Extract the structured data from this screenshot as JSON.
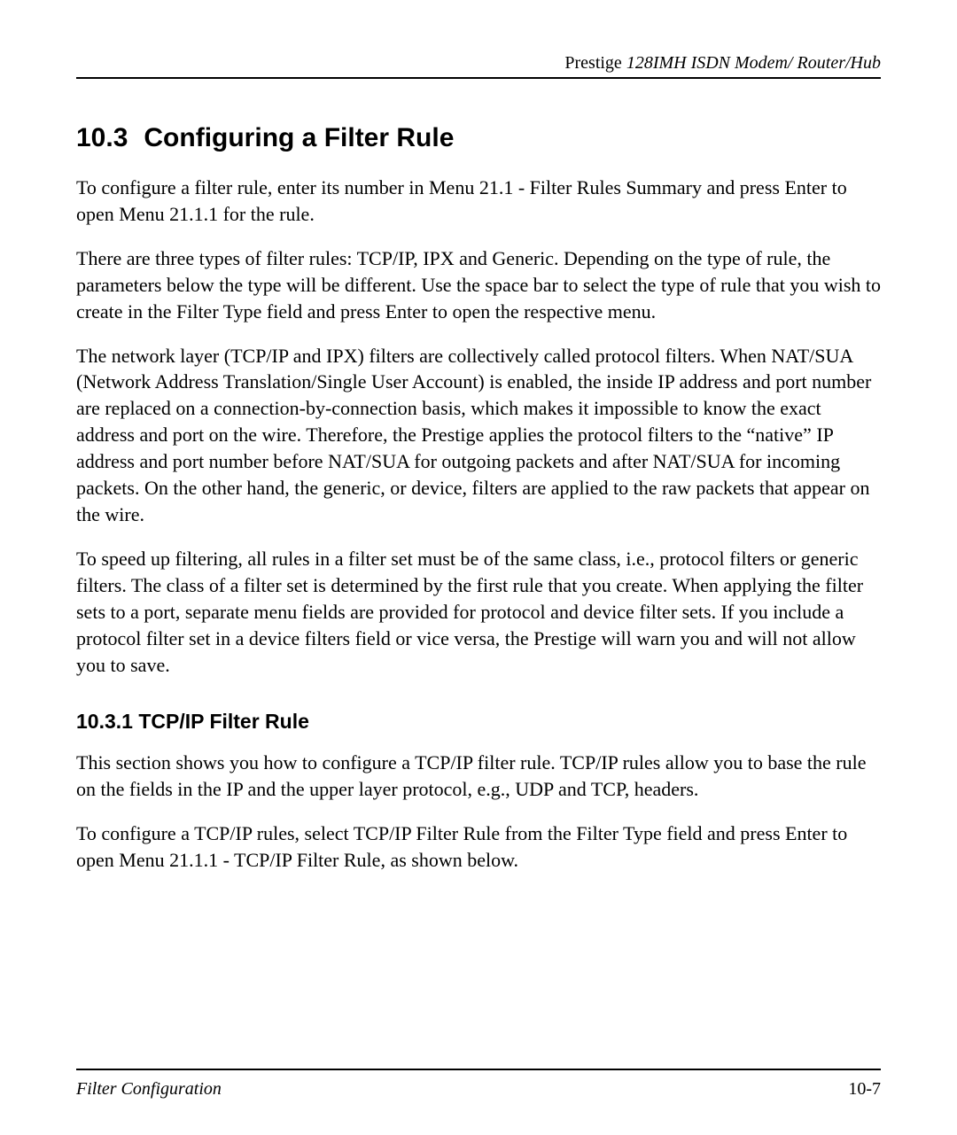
{
  "header": {
    "prefix": "Prestige ",
    "suffix": "128IMH  ISDN Modem/ Router/Hub"
  },
  "section": {
    "number": "10.3",
    "title": "Configuring a Filter Rule"
  },
  "paragraphs": {
    "p1": "To configure a filter rule, enter its number in Menu 21.1 - Filter Rules Summary and press Enter to open Menu 21.1.1 for the rule.",
    "p2": "There are three types of filter rules: TCP/IP, IPX and Generic.  Depending on the type of rule, the parameters below the type will be different.  Use the space bar to select the type of rule that you wish to create in the Filter Type field and press Enter to open the respective menu.",
    "p3": "The network layer (TCP/IP and IPX) filters are collectively called protocol filters. When NAT/SUA (Network Address Translation/Single User Account) is enabled, the inside IP address and port number are replaced on a connection-by-connection basis, which makes it impossible to know the exact address and port on the wire.  Therefore, the Prestige applies the protocol filters to the “native” IP address and port number before NAT/SUA for outgoing packets and after NAT/SUA for incoming packets.  On the other hand, the generic, or device, filters are applied to the raw packets that appear on the wire.",
    "p4": "To speed up filtering, all rules in a filter set must be of the same class, i.e., protocol filters or generic filters.  The class of a filter set is determined by the first rule that you create.  When applying the filter sets to a port, separate menu fields are provided for protocol and device filter sets.  If you include a protocol filter set in a device filters field or vice versa, the Prestige will warn you and will not allow you to save."
  },
  "subsection": {
    "number": "10.3.1",
    "title": "TCP/IP Filter Rule"
  },
  "subparagraphs": {
    "p1": "This section shows you how to configure a TCP/IP filter rule.  TCP/IP rules allow you to base the rule on the fields in the IP and the upper layer protocol, e.g., UDP and TCP, headers.",
    "p2": "To configure a TCP/IP rules, select TCP/IP Filter Rule from the Filter Type field and press Enter to open Menu 21.1.1 - TCP/IP Filter Rule, as shown below."
  },
  "footer": {
    "left": "Filter Configuration",
    "right": "10-7"
  }
}
